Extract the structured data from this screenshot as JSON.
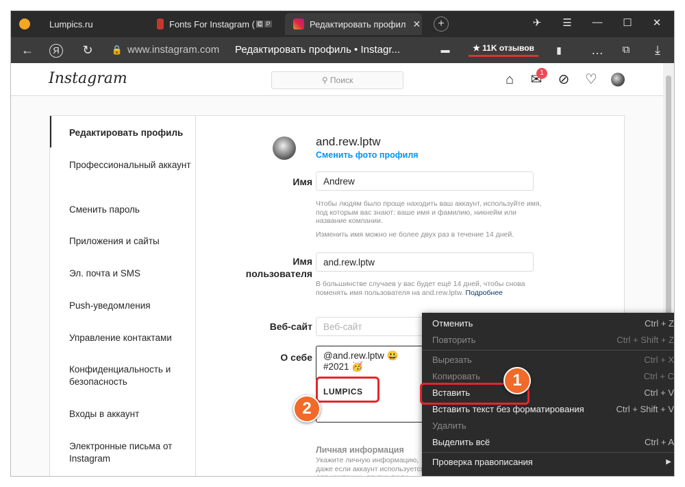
{
  "browser": {
    "tabs": [
      {
        "label": "Lumpics.ru",
        "color": "#f5a623"
      },
      {
        "label": "Fonts For Instagram (",
        "color": "#c0392b"
      },
      {
        "label": "Редактировать профил",
        "color": "#c13584"
      }
    ],
    "url_host": "www.instagram.com",
    "url_title": "Редактировать профиль • Instagr...",
    "reviews": "★ 11K отзывов"
  },
  "instagram": {
    "logo": "Instagram",
    "search_placeholder": "⚲ Поиск",
    "notification_count": "1"
  },
  "sidebar": {
    "items": [
      {
        "label": "Редактировать профиль"
      },
      {
        "label": "Профессиональный аккаунт"
      },
      {
        "label": "Сменить пароль"
      },
      {
        "label": "Приложения и сайты"
      },
      {
        "label": "Эл. почта и SMS"
      },
      {
        "label": "Push-уведомления"
      },
      {
        "label": "Управление контактами"
      },
      {
        "label": "Конфиденциальность и безопасность"
      },
      {
        "label": "Входы в аккаунт"
      },
      {
        "label": "Электронные письма от Instagram"
      }
    ]
  },
  "profile": {
    "username": "and.rew.lptw",
    "change_photo": "Сменить фото профиля",
    "name_label": "Имя",
    "name_value": "Andrew",
    "name_help": "Чтобы людям было проще находить ваш аккаунт, используйте имя, под которым вас знают: ваше имя и фамилию, никнейм или название компании.",
    "name_help2": "Изменить имя можно не более двух раз в течение 14 дней.",
    "username_label": "Имя пользователя",
    "username_value": "and.rew.lptw",
    "username_help": "В большинстве случаев у вас будет ещё 14 дней, чтобы снова поменять имя пользователя на and.rew.lptw.",
    "username_help_link": "Подробнее",
    "website_label": "Веб-сайт",
    "website_placeholder": "Веб-сайт",
    "bio_label": "О себе",
    "bio_line1": "@and.rew.lptw 😃",
    "bio_line2": "#2021 🥳",
    "bio_paste": "LUMPICS",
    "personal_info_title": "Личная информация",
    "personal_info_help": "Укажите личную информацию, даже если аккаунт используется для компании, другие люди..."
  },
  "context_menu": {
    "items": [
      {
        "label": "Отменить",
        "shortcut": "Ctrl + Z",
        "disabled": false
      },
      {
        "label": "Повторить",
        "shortcut": "Ctrl + Shift + Z",
        "disabled": true
      },
      {
        "label": "Вырезать",
        "shortcut": "Ctrl + X",
        "disabled": true
      },
      {
        "label": "Копировать",
        "shortcut": "Ctrl + C",
        "disabled": true
      },
      {
        "label": "Вставить",
        "shortcut": "Ctrl + V",
        "disabled": false
      },
      {
        "label": "Вставить текст без форматирования",
        "shortcut": "Ctrl + Shift + V",
        "disabled": false
      },
      {
        "label": "Удалить",
        "shortcut": "",
        "disabled": true
      },
      {
        "label": "Выделить всё",
        "shortcut": "Ctrl + A",
        "disabled": false
      },
      {
        "label": "Проверка правописания",
        "shortcut": "",
        "disabled": false
      }
    ]
  },
  "annotations": {
    "step1": "1",
    "step2": "2"
  }
}
